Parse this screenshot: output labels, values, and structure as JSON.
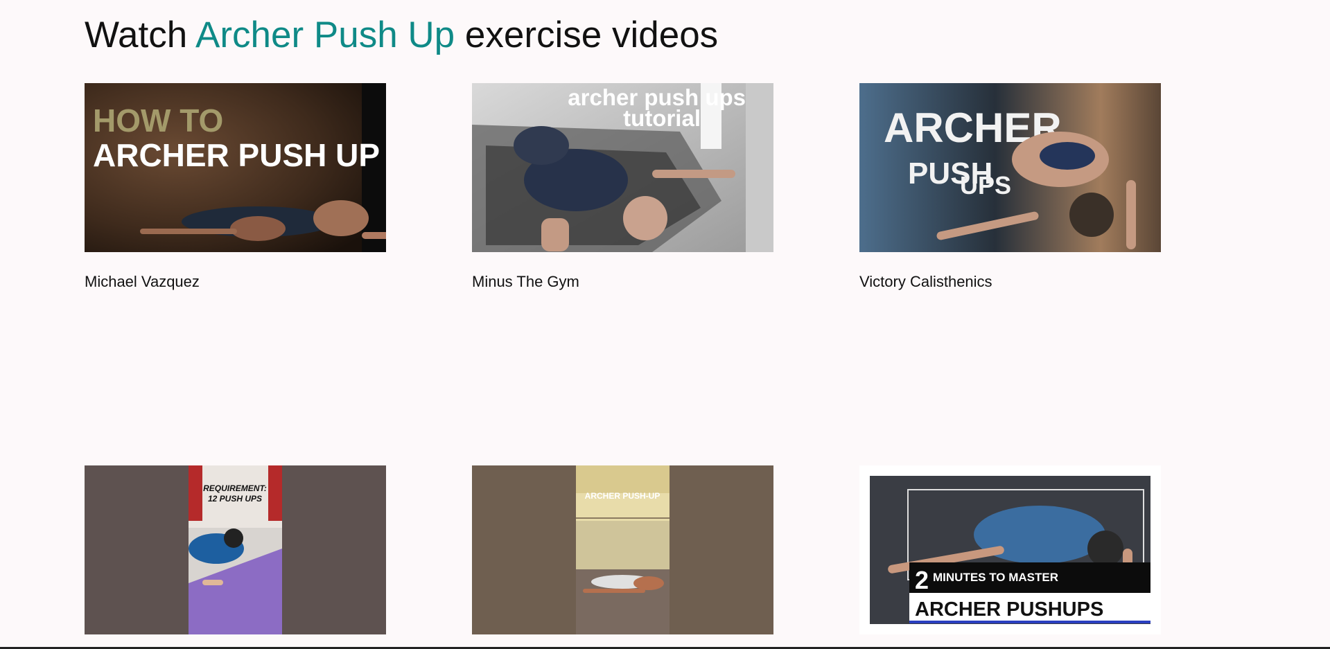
{
  "page": {
    "heading_prefix": "Watch",
    "heading_exercise": "Archer Push Up",
    "heading_suffix": "exercise videos"
  },
  "videos": [
    {
      "channel": "Michael Vazquez",
      "thumb_text_line1": "HOW TO",
      "thumb_text_line2": "ARCHER PUSH UP"
    },
    {
      "channel": "Minus The Gym",
      "thumb_text_line1": "archer push ups",
      "thumb_text_line2": "tutorial"
    },
    {
      "channel": "Victory Calisthenics",
      "thumb_text_line1": "ARCHER",
      "thumb_text_line2": "PUSH",
      "thumb_text_line3": "UPS"
    },
    {
      "channel": "",
      "thumb_text_line1": "REQUIREMENT:",
      "thumb_text_line2": "12 PUSH UPS"
    },
    {
      "channel": "",
      "thumb_text_line1": "ARCHER PUSH-UP"
    },
    {
      "channel": "",
      "thumb_text_line1": "2",
      "thumb_text_line2": "MINUTES TO MASTER",
      "thumb_text_line3": "ARCHER PUSHUPS"
    }
  ],
  "colors": {
    "accent": "#0f8a87",
    "background": "#fdf9fa"
  }
}
